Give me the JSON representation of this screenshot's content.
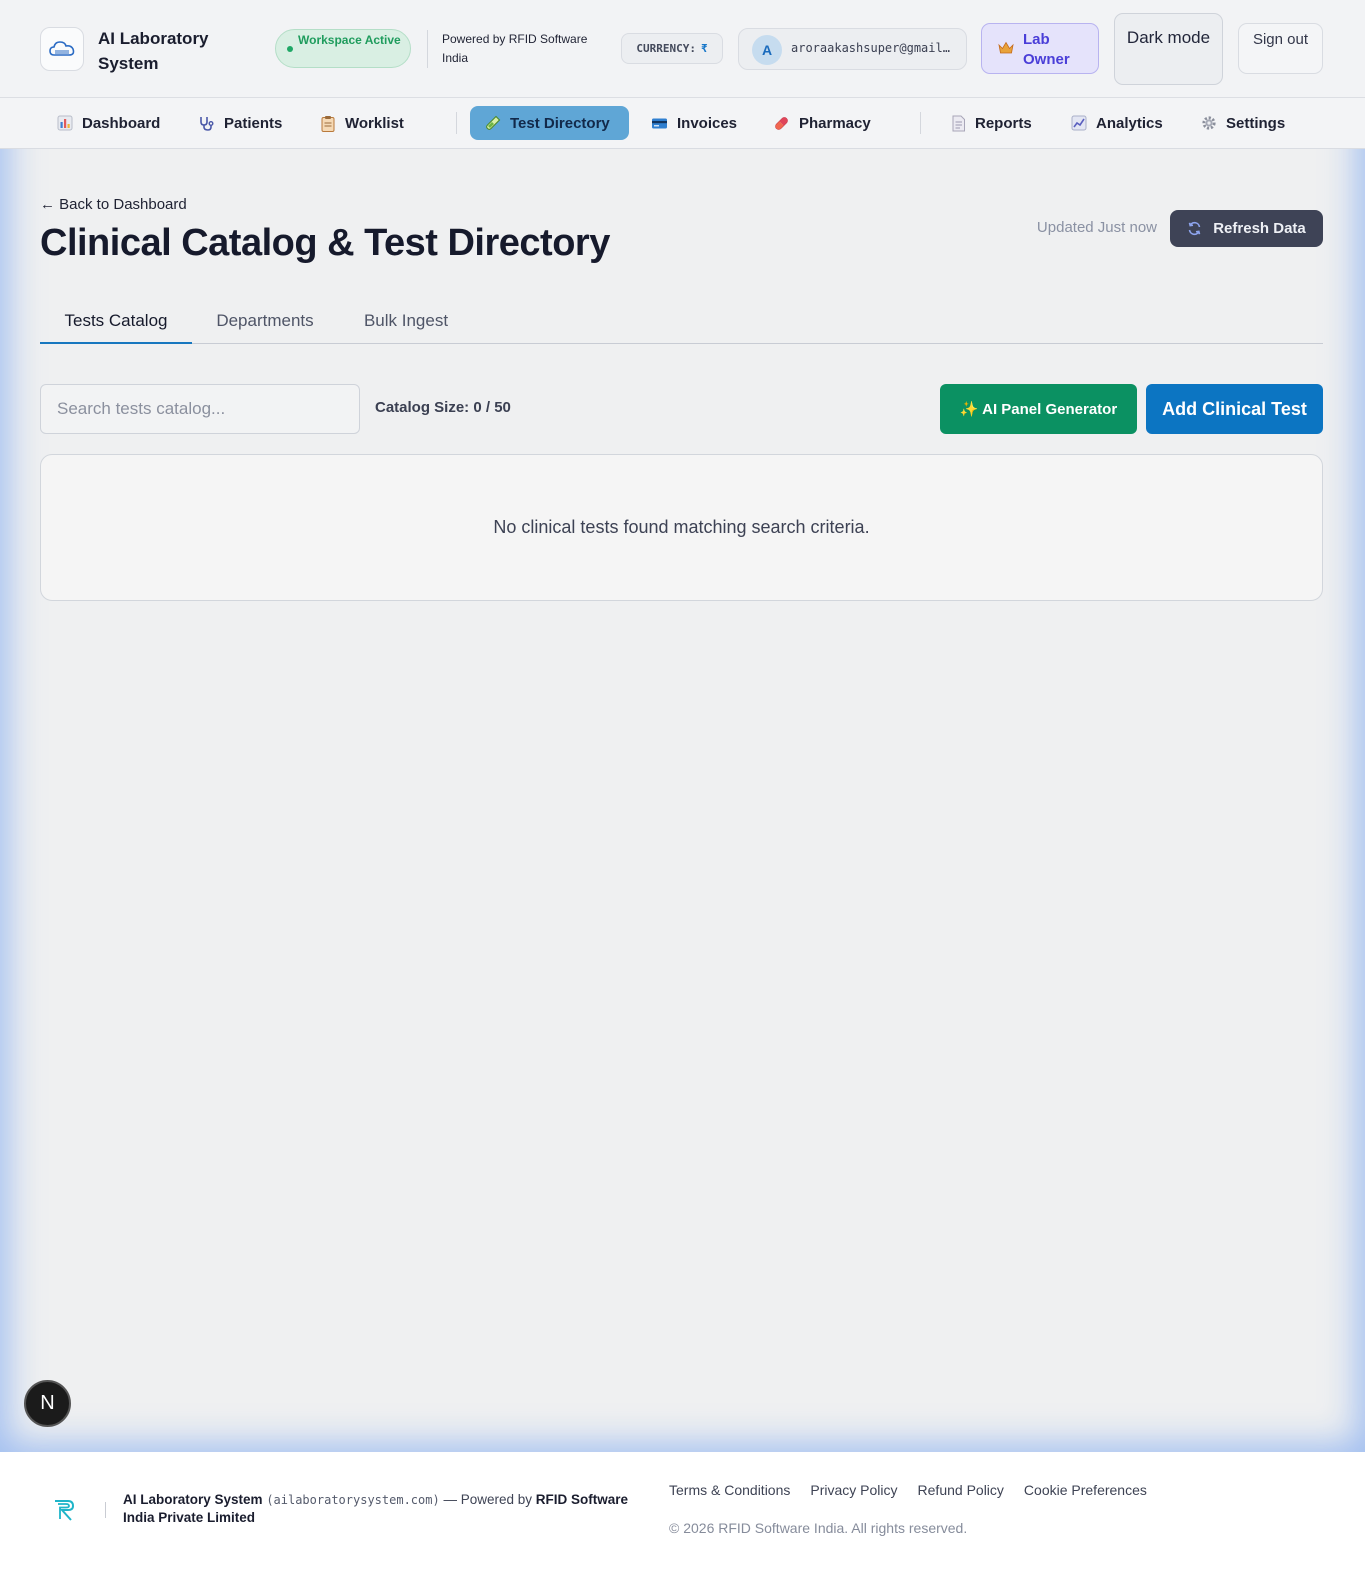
{
  "header": {
    "app_title": "AI Laboratory System",
    "status": "Workspace Active",
    "powered_by": "Powered by RFID Software India",
    "currency_label": "CURRENCY:",
    "currency_symbol": "₹",
    "user_initial": "A",
    "user_email": "aroraakashsuper@gmail.com",
    "role": "Lab Owner",
    "dark_mode": "Dark mode",
    "sign_out": "Sign out"
  },
  "nav": {
    "items": [
      {
        "label": "Dashboard",
        "icon": "bar-chart-icon"
      },
      {
        "label": "Patients",
        "icon": "stethoscope-icon"
      },
      {
        "label": "Worklist",
        "icon": "clipboard-icon"
      },
      {
        "label": "Test Directory",
        "icon": "test-tube-icon",
        "active": true
      },
      {
        "label": "Invoices",
        "icon": "credit-card-icon"
      },
      {
        "label": "Pharmacy",
        "icon": "pill-icon"
      },
      {
        "label": "Reports",
        "icon": "document-icon"
      },
      {
        "label": "Analytics",
        "icon": "line-chart-icon"
      },
      {
        "label": "Settings",
        "icon": "gear-icon"
      }
    ],
    "active_color": "#5fa6d6"
  },
  "page": {
    "back_link": "← Back to Dashboard",
    "title": "Clinical Catalog & Test Directory",
    "updated": "Updated Just now",
    "refresh": "Refresh Data"
  },
  "tabs": {
    "items": [
      "Tests Catalog",
      "Departments",
      "Bulk Ingest"
    ],
    "active": "Tests Catalog"
  },
  "toolbar": {
    "search_placeholder": "Search tests catalog...",
    "search_value": "",
    "catalog_size": "Catalog Size: 0 / 50",
    "ai_button": "✨ AI Panel Generator",
    "add_button": "Add Clinical Test"
  },
  "empty_state": "No clinical tests found matching search criteria.",
  "floating_badge": "N",
  "footer": {
    "brand": "AI Laboratory System",
    "domain": "(ailaboratorysystem.com)",
    "powered_prefix": " — Powered by ",
    "company": "RFID Software India Private Limited",
    "links": [
      "Terms & Conditions",
      "Privacy Policy",
      "Refund Policy",
      "Cookie Preferences"
    ],
    "copyright": "© 2026 RFID Software India. All rights reserved."
  },
  "colors": {
    "accent_blue": "#0c75c2",
    "ai_green": "#0b9162",
    "role_purple": "#4a3ed8",
    "refresh_dark": "#3e4356"
  }
}
